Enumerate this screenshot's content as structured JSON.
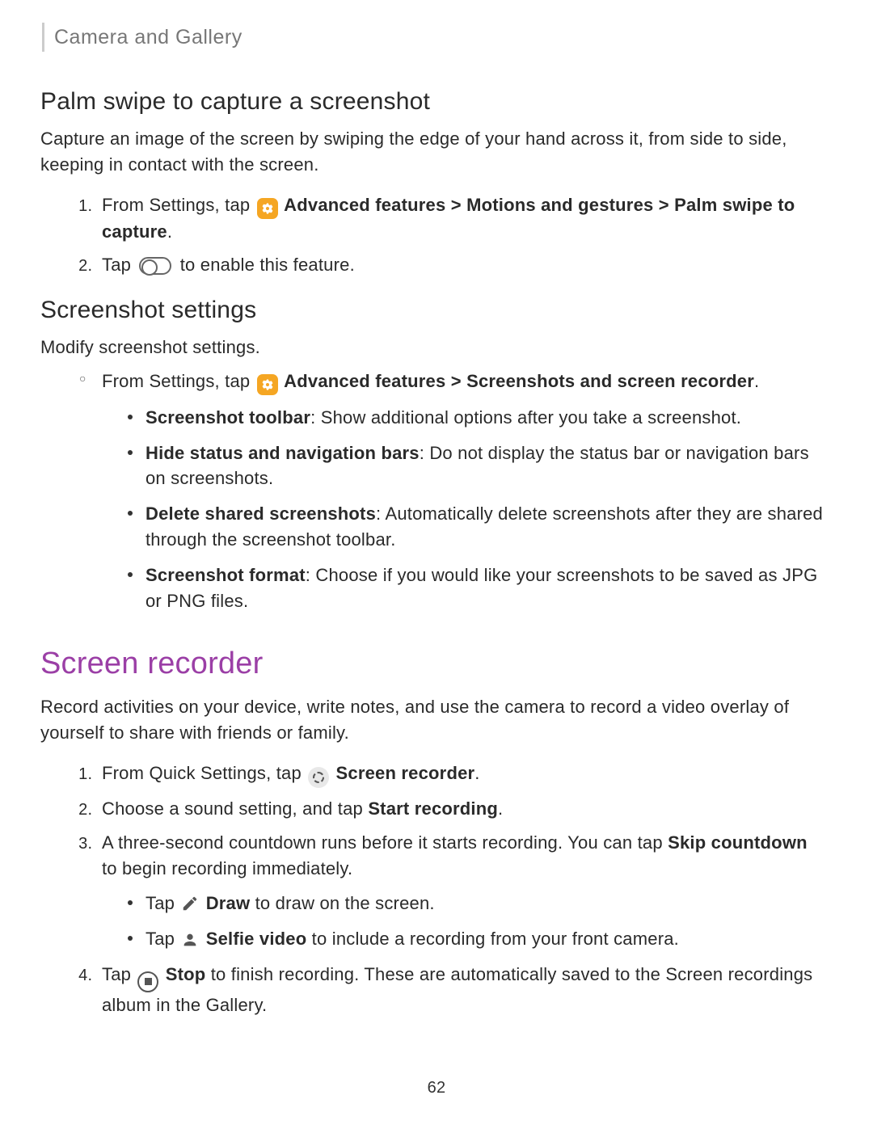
{
  "header": {
    "breadcrumb": "Camera and Gallery"
  },
  "s1": {
    "title": "Palm swipe to capture a screenshot",
    "intro": "Capture an image of the screen by swiping the edge of your hand across it, from side to side, keeping in contact with the screen.",
    "step1_pre": "From Settings, tap ",
    "step1_bold": " Advanced features > Motions and gestures > Palm swipe to capture",
    "step1_dot": ".",
    "step2_pre": "Tap ",
    "step2_post": " to enable this feature."
  },
  "s2": {
    "title": "Screenshot settings",
    "intro": "Modify screenshot settings.",
    "lead_pre": "From Settings, tap ",
    "lead_bold": " Advanced features > Screenshots and screen recorder",
    "lead_dot": ".",
    "b1_bold": "Screenshot toolbar",
    "b1_text": ": Show additional options after you take a screenshot.",
    "b2_bold": "Hide status and navigation bars",
    "b2_text": ": Do not display the status bar or navigation bars on screenshots.",
    "b3_bold": "Delete shared screenshots",
    "b3_text": ": Automatically delete screenshots after they are shared through the screenshot toolbar.",
    "b4_bold": "Screenshot format",
    "b4_text": ": Choose if you would like your screenshots to be saved as JPG or PNG files."
  },
  "s3": {
    "title": "Screen recorder",
    "intro": "Record activities on your device, write notes, and use the camera to record a video overlay of yourself to share with friends or family.",
    "st1_pre": "From Quick Settings, tap ",
    "st1_bold": " Screen recorder",
    "st1_dot": ".",
    "st2_pre": "Choose a sound setting, and tap ",
    "st2_bold": "Start recording",
    "st2_dot": ".",
    "st3_pre": "A three-second countdown runs before it starts recording. You can tap ",
    "st3_bold": "Skip countdown",
    "st3_post": " to begin recording immediately.",
    "sub1_pre": "Tap ",
    "sub1_bold": " Draw",
    "sub1_post": " to draw on the screen.",
    "sub2_pre": "Tap ",
    "sub2_bold": " Selfie video",
    "sub2_post": " to include a recording from your front camera.",
    "st4_pre": "Tap ",
    "st4_bold": " Stop",
    "st4_post": " to finish recording. These are automatically saved to the Screen recordings album in the Gallery."
  },
  "page": "62"
}
